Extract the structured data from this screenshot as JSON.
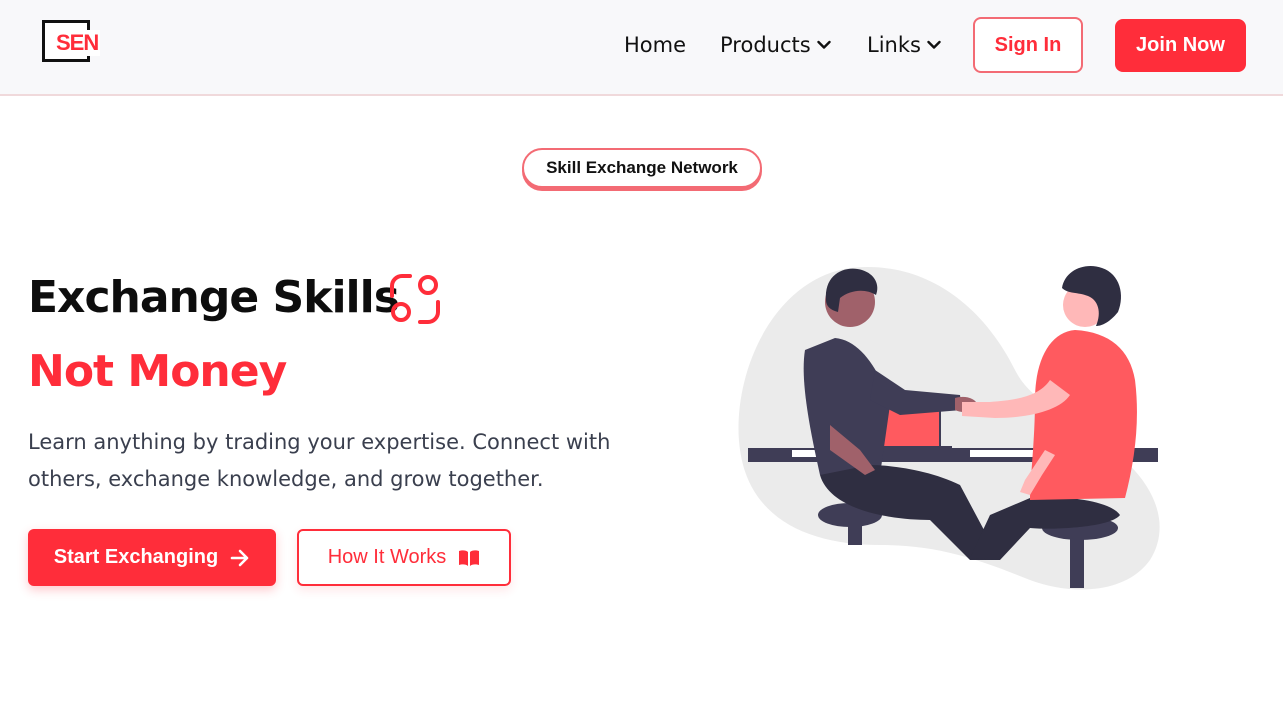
{
  "header": {
    "logo_text": "SEN",
    "nav": [
      {
        "label": "Home"
      },
      {
        "label": "Products"
      },
      {
        "label": "Links"
      }
    ],
    "sign_in": "Sign In",
    "join_now": "Join Now"
  },
  "badge": "Skill Exchange Network",
  "hero": {
    "title": "Exchange Skills",
    "subtitle": "Not Money",
    "description": "Learn anything by trading your expertise. Connect with others, exchange knowledge, and grow together.",
    "primary_button": "Start Exchanging",
    "secondary_button": "How It Works"
  },
  "colors": {
    "accent": "#ff2d3a",
    "dark": "#3f3d56",
    "header_bg": "#f8f8fa"
  },
  "icons": [
    "chevron-down-icon",
    "exchange-icon",
    "arrow-right-icon",
    "book-icon",
    "handshake-illustration"
  ]
}
